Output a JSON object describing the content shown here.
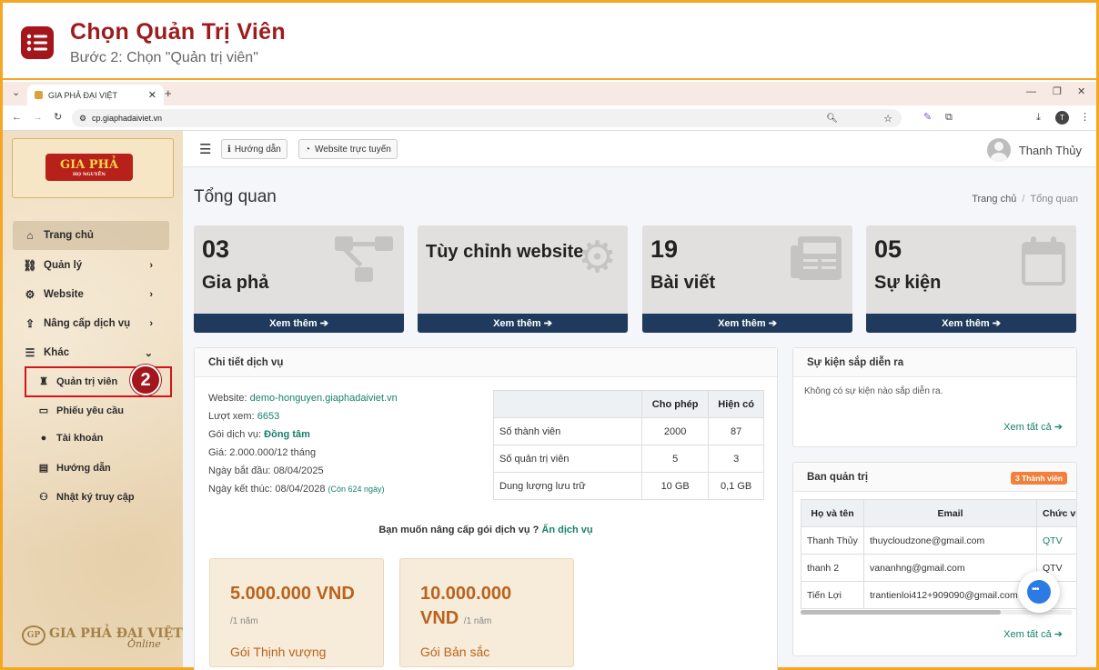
{
  "guide": {
    "title": "Chọn Quản Trị Viên",
    "subtitle": "Bước 2: Chọn \"Quản trị viên\""
  },
  "browser": {
    "tab_title": "GIA PHẢ ĐẠI VIỆT",
    "url": "cp.giaphadaiviet.vn",
    "profile_initial": "T"
  },
  "sidebar": {
    "logo_text": "GIA PHẢ",
    "logo_sub": "HỌ NGUYỄN",
    "items": [
      {
        "label": "Trang chủ",
        "icon": "home-icon"
      },
      {
        "label": "Quản lý",
        "icon": "sitemap-icon"
      },
      {
        "label": "Website",
        "icon": "gear-icon"
      },
      {
        "label": "Nâng cấp dịch vụ",
        "icon": "upgrade-icon"
      },
      {
        "label": "Khác",
        "icon": "bars-icon"
      }
    ],
    "sub_items": [
      {
        "label": "Quản trị viên",
        "icon": "admin-icon"
      },
      {
        "label": "Phiếu yêu cầu",
        "icon": "ticket-icon"
      },
      {
        "label": "Tài khoản",
        "icon": "user-icon"
      },
      {
        "label": "Hướng dẫn",
        "icon": "file-icon"
      },
      {
        "label": "Nhật ký truy cập",
        "icon": "users-icon"
      }
    ],
    "step_number": "2",
    "footer_logo": "GIA PHẢ ĐẠI VIỆT",
    "footer_online": "Online"
  },
  "topbar": {
    "guide_button": "Hướng dẫn",
    "website_button": "Website trực tuyến",
    "user_name": "Thanh Thủy"
  },
  "page": {
    "title": "Tổng quan",
    "breadcrumb_home": "Trang chủ",
    "breadcrumb_current": "Tổng quan"
  },
  "stats": [
    {
      "number": "03",
      "label": "Gia phả",
      "more": "Xem thêm"
    },
    {
      "number": "",
      "label": "Tùy chỉnh website",
      "more": "Xem thêm"
    },
    {
      "number": "19",
      "label": "Bài viết",
      "more": "Xem thêm"
    },
    {
      "number": "05",
      "label": "Sự kiện",
      "more": "Xem thêm"
    }
  ],
  "service": {
    "title": "Chi tiết dịch vụ",
    "website_label": "Website:",
    "website_value": "demo-honguyen.giaphadaiviet.vn",
    "views_label": "Lượt xem:",
    "views_value": "6653",
    "plan_label": "Gói dịch vụ:",
    "plan_value": "Đồng tâm",
    "price_label": "Giá:",
    "price_value": "2.000.000/12 tháng",
    "start_label": "Ngày bắt đầu:",
    "start_value": "08/04/2025",
    "end_label": "Ngày kết thúc:",
    "end_value": "08/04/2028",
    "end_note": "(Còn 624 ngày)",
    "table_headers": [
      "",
      "Cho phép",
      "Hiện có"
    ],
    "table_rows": [
      [
        "Số thành viên",
        "2000",
        "87"
      ],
      [
        "Số quản trị viên",
        "5",
        "3"
      ],
      [
        "Dung lượng lưu trữ",
        "10 GB",
        "0,1 GB"
      ]
    ],
    "upgrade_text": "Bạn muốn nâng cấp gói dịch vụ ?",
    "upgrade_link": "Ấn dịch vụ",
    "packages": [
      {
        "price": "5.000.000 VND",
        "per": "/1 năm",
        "name": "Gói Thịnh vượng"
      },
      {
        "price": "10.000.000",
        "price2": "VND",
        "per": "/1 năm",
        "name": "Gói Bản sắc"
      }
    ]
  },
  "events": {
    "title": "Sự kiện sắp diễn ra",
    "empty": "Không có sự kiện nào sắp diễn ra.",
    "view_all": "Xem tất cả"
  },
  "admins": {
    "title": "Ban quản trị",
    "badge": "3 Thành viên",
    "headers": [
      "Họ và tên",
      "Email",
      "Chức vụ"
    ],
    "rows": [
      [
        "Thanh Thủy",
        "thuycloudzone@gmail.com",
        "QTV"
      ],
      [
        "thanh 2",
        "vananhng@gmail.com",
        "QTV"
      ],
      [
        "Tiến Lợi",
        "trantienloi412+909090@gmail.com",
        ""
      ]
    ],
    "view_all": "Xem tất cả"
  },
  "colors": {
    "accent": "#a3161c",
    "navy": "#1f3a5c",
    "teal": "#17806b",
    "orange": "#f5a623"
  }
}
